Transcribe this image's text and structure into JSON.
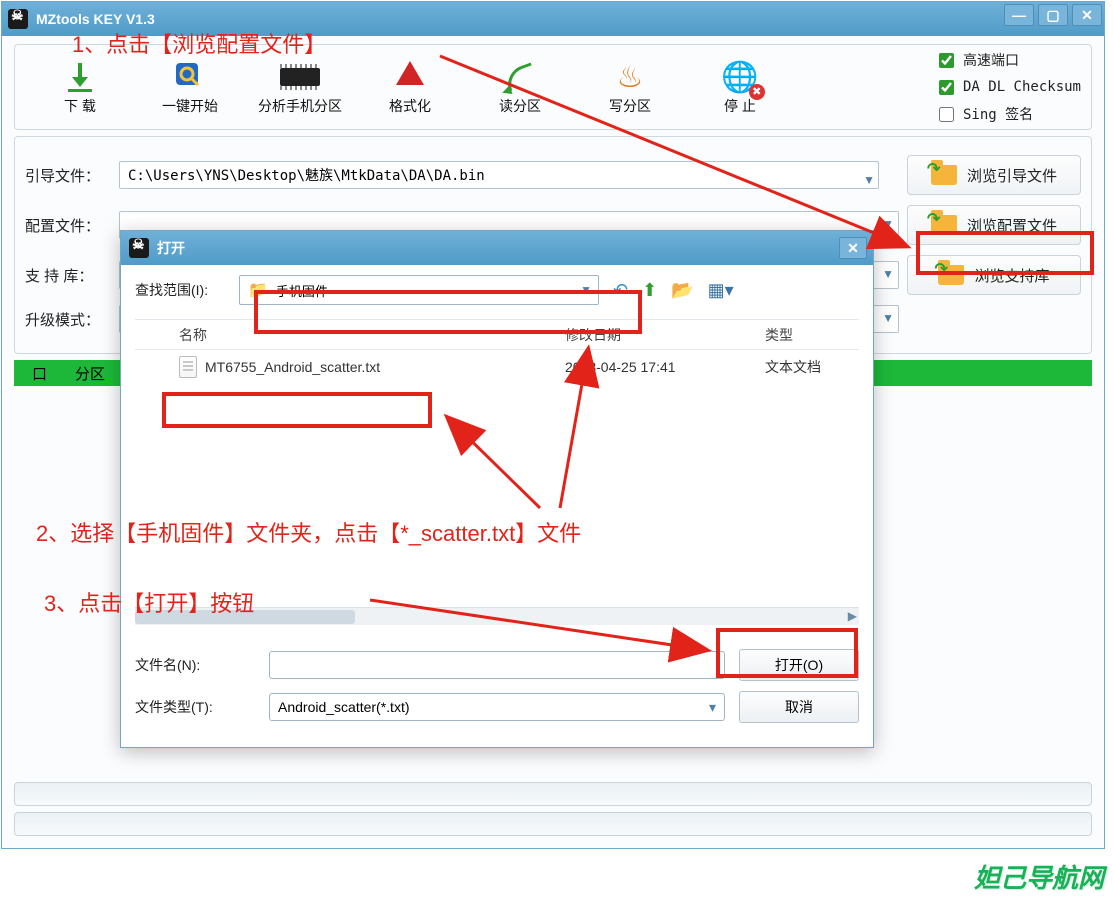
{
  "window": {
    "title": "MZtools KEY V1.3"
  },
  "toolbar": {
    "download": "下 载",
    "onekey": "一键开始",
    "analyze": "分析手机分区",
    "format": "格式化",
    "readp": "读分区",
    "writep": "写分区",
    "stop": "停 止"
  },
  "checks": {
    "highspeed": "高速端口",
    "checksum": "DA DL Checksum",
    "sign": "Sing 签名"
  },
  "rows": {
    "boot_label": "引导文件：",
    "boot_path": "C:\\Users\\YNS\\Desktop\\魅族\\MtkData\\DA\\DA.bin",
    "browse_boot": "浏览引导文件",
    "cfg_label": "配置文件：",
    "browse_cfg": "浏览配置文件",
    "lib_label": "支 持 库：",
    "browse_lib": "浏览支持库",
    "mode_label": "升级模式："
  },
  "list_head": {
    "col1": "口",
    "col2": "分区"
  },
  "dialog": {
    "title": "打开",
    "scope_label": "查找范围(I):",
    "scope_value": "手机固件",
    "col_name": "名称",
    "col_date": "修改日期",
    "col_type": "类型",
    "file_name": "MT6755_Android_scatter.txt",
    "file_date": "2018-04-25 17:41",
    "file_type": "文本文档",
    "fname_label": "文件名(N):",
    "ftype_label": "文件类型(T):",
    "ftype_value": "Android_scatter(*.txt)",
    "open_btn": "打开(O)",
    "cancel_btn": "取消"
  },
  "annotations": {
    "a1": "1、点击【浏览配置文件】",
    "a2": "2、选择【手机固件】文件夹，点击【*_scatter.txt】文件",
    "a3": "3、点击【打开】按钮"
  },
  "watermark": "妲己导航网"
}
